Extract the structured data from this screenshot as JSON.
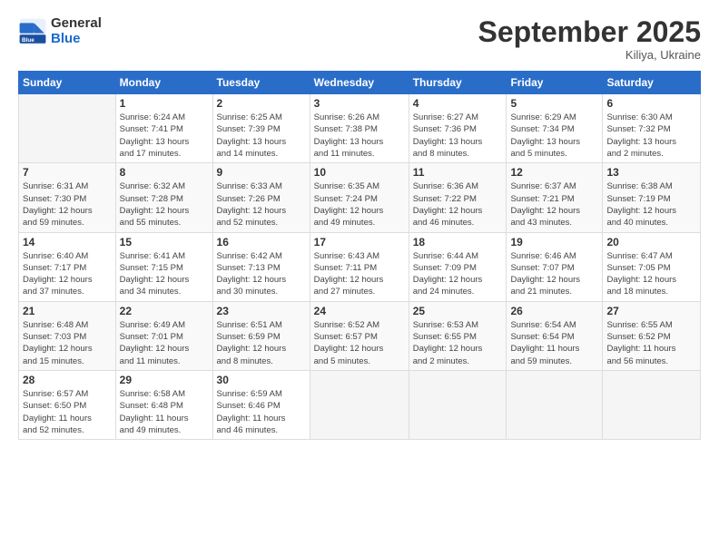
{
  "logo": {
    "general": "General",
    "blue": "Blue"
  },
  "title": "September 2025",
  "subtitle": "Kiliya, Ukraine",
  "days_header": [
    "Sunday",
    "Monday",
    "Tuesday",
    "Wednesday",
    "Thursday",
    "Friday",
    "Saturday"
  ],
  "weeks": [
    [
      {
        "day": "",
        "info": ""
      },
      {
        "day": "1",
        "info": "Sunrise: 6:24 AM\nSunset: 7:41 PM\nDaylight: 13 hours\nand 17 minutes."
      },
      {
        "day": "2",
        "info": "Sunrise: 6:25 AM\nSunset: 7:39 PM\nDaylight: 13 hours\nand 14 minutes."
      },
      {
        "day": "3",
        "info": "Sunrise: 6:26 AM\nSunset: 7:38 PM\nDaylight: 13 hours\nand 11 minutes."
      },
      {
        "day": "4",
        "info": "Sunrise: 6:27 AM\nSunset: 7:36 PM\nDaylight: 13 hours\nand 8 minutes."
      },
      {
        "day": "5",
        "info": "Sunrise: 6:29 AM\nSunset: 7:34 PM\nDaylight: 13 hours\nand 5 minutes."
      },
      {
        "day": "6",
        "info": "Sunrise: 6:30 AM\nSunset: 7:32 PM\nDaylight: 13 hours\nand 2 minutes."
      }
    ],
    [
      {
        "day": "7",
        "info": "Sunrise: 6:31 AM\nSunset: 7:30 PM\nDaylight: 12 hours\nand 59 minutes."
      },
      {
        "day": "8",
        "info": "Sunrise: 6:32 AM\nSunset: 7:28 PM\nDaylight: 12 hours\nand 55 minutes."
      },
      {
        "day": "9",
        "info": "Sunrise: 6:33 AM\nSunset: 7:26 PM\nDaylight: 12 hours\nand 52 minutes."
      },
      {
        "day": "10",
        "info": "Sunrise: 6:35 AM\nSunset: 7:24 PM\nDaylight: 12 hours\nand 49 minutes."
      },
      {
        "day": "11",
        "info": "Sunrise: 6:36 AM\nSunset: 7:22 PM\nDaylight: 12 hours\nand 46 minutes."
      },
      {
        "day": "12",
        "info": "Sunrise: 6:37 AM\nSunset: 7:21 PM\nDaylight: 12 hours\nand 43 minutes."
      },
      {
        "day": "13",
        "info": "Sunrise: 6:38 AM\nSunset: 7:19 PM\nDaylight: 12 hours\nand 40 minutes."
      }
    ],
    [
      {
        "day": "14",
        "info": "Sunrise: 6:40 AM\nSunset: 7:17 PM\nDaylight: 12 hours\nand 37 minutes."
      },
      {
        "day": "15",
        "info": "Sunrise: 6:41 AM\nSunset: 7:15 PM\nDaylight: 12 hours\nand 34 minutes."
      },
      {
        "day": "16",
        "info": "Sunrise: 6:42 AM\nSunset: 7:13 PM\nDaylight: 12 hours\nand 30 minutes."
      },
      {
        "day": "17",
        "info": "Sunrise: 6:43 AM\nSunset: 7:11 PM\nDaylight: 12 hours\nand 27 minutes."
      },
      {
        "day": "18",
        "info": "Sunrise: 6:44 AM\nSunset: 7:09 PM\nDaylight: 12 hours\nand 24 minutes."
      },
      {
        "day": "19",
        "info": "Sunrise: 6:46 AM\nSunset: 7:07 PM\nDaylight: 12 hours\nand 21 minutes."
      },
      {
        "day": "20",
        "info": "Sunrise: 6:47 AM\nSunset: 7:05 PM\nDaylight: 12 hours\nand 18 minutes."
      }
    ],
    [
      {
        "day": "21",
        "info": "Sunrise: 6:48 AM\nSunset: 7:03 PM\nDaylight: 12 hours\nand 15 minutes."
      },
      {
        "day": "22",
        "info": "Sunrise: 6:49 AM\nSunset: 7:01 PM\nDaylight: 12 hours\nand 11 minutes."
      },
      {
        "day": "23",
        "info": "Sunrise: 6:51 AM\nSunset: 6:59 PM\nDaylight: 12 hours\nand 8 minutes."
      },
      {
        "day": "24",
        "info": "Sunrise: 6:52 AM\nSunset: 6:57 PM\nDaylight: 12 hours\nand 5 minutes."
      },
      {
        "day": "25",
        "info": "Sunrise: 6:53 AM\nSunset: 6:55 PM\nDaylight: 12 hours\nand 2 minutes."
      },
      {
        "day": "26",
        "info": "Sunrise: 6:54 AM\nSunset: 6:54 PM\nDaylight: 11 hours\nand 59 minutes."
      },
      {
        "day": "27",
        "info": "Sunrise: 6:55 AM\nSunset: 6:52 PM\nDaylight: 11 hours\nand 56 minutes."
      }
    ],
    [
      {
        "day": "28",
        "info": "Sunrise: 6:57 AM\nSunset: 6:50 PM\nDaylight: 11 hours\nand 52 minutes."
      },
      {
        "day": "29",
        "info": "Sunrise: 6:58 AM\nSunset: 6:48 PM\nDaylight: 11 hours\nand 49 minutes."
      },
      {
        "day": "30",
        "info": "Sunrise: 6:59 AM\nSunset: 6:46 PM\nDaylight: 11 hours\nand 46 minutes."
      },
      {
        "day": "",
        "info": ""
      },
      {
        "day": "",
        "info": ""
      },
      {
        "day": "",
        "info": ""
      },
      {
        "day": "",
        "info": ""
      }
    ]
  ]
}
